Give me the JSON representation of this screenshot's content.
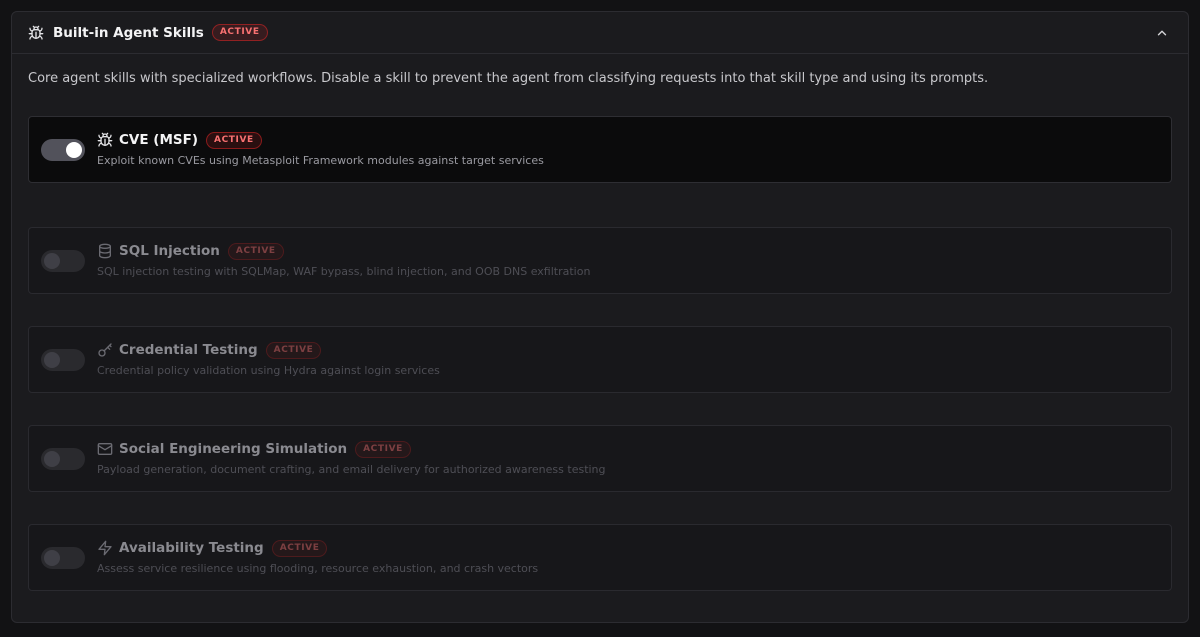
{
  "panel": {
    "title": "Built-in Agent Skills",
    "badge": "ACTIVE",
    "icon": "bug-icon",
    "collapse_icon": "chevron-up-icon",
    "description": "Core agent skills with specialized workflows. Disable a skill to prevent the agent from classifying requests into that skill type and using its prompts."
  },
  "skills": [
    {
      "name": "CVE (MSF)",
      "badge": "ACTIVE",
      "icon": "bug-icon",
      "enabled": true,
      "description": "Exploit known CVEs using Metasploit Framework modules against target services"
    },
    {
      "name": "SQL Injection",
      "badge": "ACTIVE",
      "icon": "database-icon",
      "enabled": false,
      "description": "SQL injection testing with SQLMap, WAF bypass, blind injection, and OOB DNS exfiltration"
    },
    {
      "name": "Credential Testing",
      "badge": "ACTIVE",
      "icon": "key-icon",
      "enabled": false,
      "description": "Credential policy validation using Hydra against login services"
    },
    {
      "name": "Social Engineering Simulation",
      "badge": "ACTIVE",
      "icon": "mail-icon",
      "enabled": false,
      "description": "Payload generation, document crafting, and email delivery for authorized awareness testing"
    },
    {
      "name": "Availability Testing",
      "badge": "ACTIVE",
      "icon": "zap-icon",
      "enabled": false,
      "description": "Assess service resilience using flooding, resource exhaustion, and crash vectors"
    }
  ],
  "colors": {
    "accent": "#f87171",
    "panel_bg": "#1b1b1e",
    "enabled_card_bg": "#0b0b0c"
  }
}
